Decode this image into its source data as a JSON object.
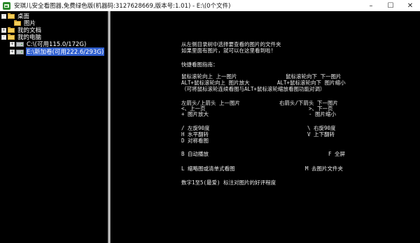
{
  "window": {
    "title": "安琪儿安全看图器,免费绿色版(机器码:3127628669,版本号:1.01) - E:\\(0个文件)",
    "controls": {
      "minimize": "–",
      "maximize": "☐",
      "close": "✕"
    }
  },
  "tree": {
    "items": [
      {
        "label": "桌面",
        "expander": "-",
        "icon": "folder-icon"
      },
      {
        "label": "图片",
        "expander": "",
        "icon": "folder-icon"
      },
      {
        "label": "我的文档",
        "expander": "+",
        "icon": "folder-icon"
      },
      {
        "label": "我的电脑",
        "expander": "-",
        "icon": "folder-icon"
      },
      {
        "label": "C:\\(可用115.0/172G)",
        "expander": "+",
        "icon": "drive-icon"
      },
      {
        "label": "E:\\新加卷(可用222.6/293G)",
        "expander": "+",
        "icon": "drive-icon",
        "selected": true
      }
    ]
  },
  "guide": {
    "intro1": "从左侧目录树中选择要查看的图片的文件夹",
    "intro2": "如果里面有图片，就可以在这里看到啦!",
    "heading": "快捷看图指南：",
    "wheel_up": "鼠标滚轮向上 上一图片",
    "wheel_down": "鼠标滚轮向下 下一图片",
    "alt_up": "ALT+鼠标滚轮向上 图片放大",
    "alt_down": "ALT+鼠标滚轮向下 图片缩小",
    "wheel_note": "（可将鼠标滚轮连续看图与ALT+鼠标滚轮缩放看图功能对调）",
    "left_up": "左箭头/上箭头 上一图片",
    "right_down": "右箭头/下箭头 下一图片",
    "lt_prev": "<、上一页",
    "gt_next": ">、下一页",
    "plus_zoom": "+ 图片放大",
    "minus_zoom": "- 图片缩小",
    "slash_rot": "/ 左旋90度",
    "backslash_rot": "\\ 右旋90度",
    "h_flip": "H 水平翻转",
    "v_flip": "V 上下翻转",
    "d_contrast": "D 对称看图",
    "b_auto": "B 自动播放",
    "f_full": "F 全屏",
    "l_thumb": "L 缩略图或清单式看图",
    "m_folder": "M 去图片文件夹",
    "rating": "数字1至5(最爱) 标注对图片的好评程度"
  }
}
